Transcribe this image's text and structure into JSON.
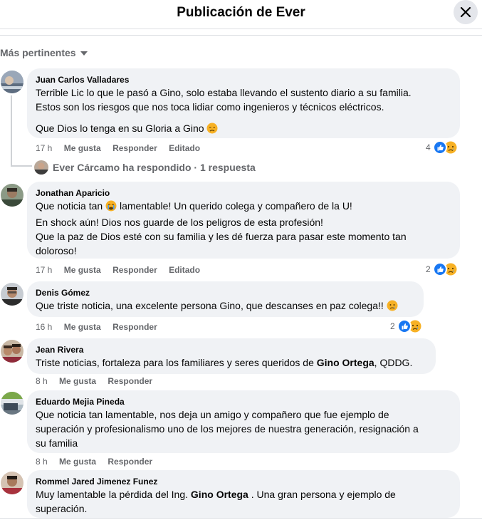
{
  "header": {
    "title": "Publicación de Ever",
    "close_icon": "close-icon"
  },
  "sort": {
    "label": "Más pertinentes"
  },
  "comments": [
    {
      "author": "Juan Carlos Valladares",
      "lines": [
        "Terrible Lic lo que le pasó a Gino, solo estaba llevando el sustento diario a su familia.",
        "Estos son los riesgos que nos toca lidiar como ingenieros y técnicos eléctricos."
      ],
      "line2": "Que Dios lo tenga en su Gloria a Gino",
      "time": "17 h",
      "like": "Me gusta",
      "reply": "Responder",
      "edited": "Editado",
      "reaction_count": "4"
    },
    {
      "author": "Jonathan Aparicio",
      "text_a": "Que noticia tan",
      "text_b": "lamentable! Un querido colega y compañero de la U!",
      "text_c": "En shock aún! Dios nos guarde de los peligros de esta profesión!",
      "text_d": "Que la paz de Dios esté con su familia y les dé fuerza para pasar este momento tan",
      "text_e": "doloroso!",
      "time": "17 h",
      "like": "Me gusta",
      "reply": "Responder",
      "edited": "Editado",
      "reaction_count": "2"
    },
    {
      "author": "Denis Gómez",
      "text": "Que triste noticia, una excelente persona Gino, que descanses en paz colega!!",
      "time": "16 h",
      "like": "Me gusta",
      "reply": "Responder",
      "reaction_count": "2"
    },
    {
      "author": "Jean Rivera",
      "text_a": "Triste noticias, fortaleza para los familiares y seres queridos de",
      "text_bold": "Gino Ortega",
      "text_b": ", QDDG.",
      "time": "8 h",
      "like": "Me gusta",
      "reply": "Responder"
    },
    {
      "author": "Eduardo Mejia Pineda",
      "lines": [
        "Que noticia tan lamentable, nos deja un amigo y compañero que fue ejemplo de",
        "superación y profesionalismo uno de los mejores de nuestra generación, resignación a",
        "su familia"
      ],
      "time": "8 h",
      "like": "Me gusta",
      "reply": "Responder"
    },
    {
      "author": "Rommel Jared Jimenez Funez",
      "text_a": "Muy lamentable la pérdida del Ing.",
      "text_bold": "Gino Ortega",
      "text_b": ". Una gran persona y ejemplo de",
      "text_c": "superación."
    }
  ],
  "reply_summary": {
    "label": "Ever Cárcamo ha respondido · 1 respuesta"
  },
  "colors": {
    "bubble": "#f0f2f5",
    "meta": "#65676b",
    "like_blue": "#1877f2",
    "sad_yellow": "#f7b125"
  }
}
